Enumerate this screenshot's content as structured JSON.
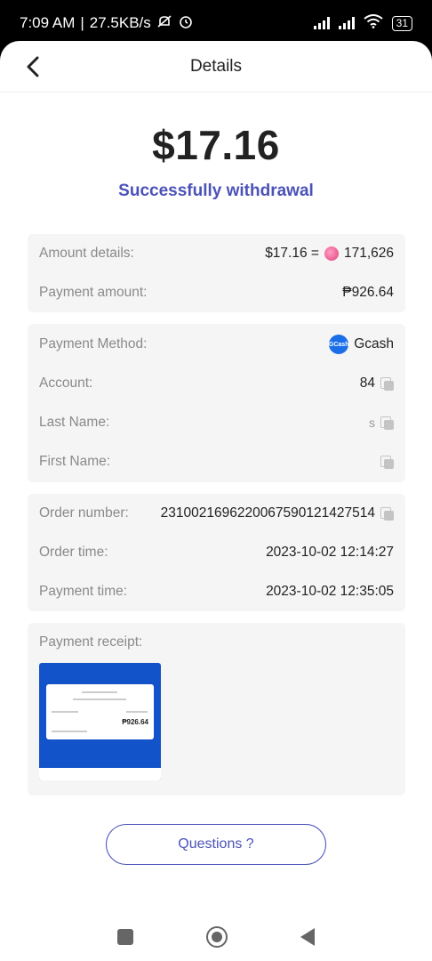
{
  "status_bar": {
    "time": "7:09 AM",
    "separator": "|",
    "speed": "27.5KB/s",
    "battery": "31"
  },
  "header": {
    "title": "Details"
  },
  "summary": {
    "amount": "$17.16",
    "status": "Successfully withdrawal"
  },
  "amount_card": {
    "amount_details_label": "Amount details:",
    "amount_details_usd": "$17.16 =",
    "amount_details_coins": "171,626",
    "payment_amount_label": "Payment amount:",
    "payment_amount_value": "₱926.64"
  },
  "method_card": {
    "method_label": "Payment Method:",
    "method_logo_text": "GCash",
    "method_value": "Gcash",
    "account_label": "Account:",
    "account_value": "84",
    "last_name_label": "Last Name:",
    "last_name_value": "s",
    "first_name_label": "First Name:"
  },
  "order_card": {
    "order_number_label": "Order number:",
    "order_number_value": "2310021696220067590121427514",
    "order_time_label": "Order time:",
    "order_time_value": "2023-10-02 12:14:27",
    "payment_time_label": "Payment time:",
    "payment_time_value": "2023-10-02 12:35:05"
  },
  "receipt_card": {
    "label": "Payment receipt:",
    "thumb_amount": "₱926.64"
  },
  "questions_button": "Questions ?",
  "colors": {
    "accent": "#4b52b8",
    "card_bg": "#f5f5f5",
    "gcash_blue": "#1353c9"
  },
  "icons": {
    "back": "chevron-left-icon",
    "copy": "copy-icon",
    "coin": "coin-icon",
    "nav_recent": "square-icon",
    "nav_home": "circle-icon",
    "nav_back": "triangle-back-icon"
  }
}
